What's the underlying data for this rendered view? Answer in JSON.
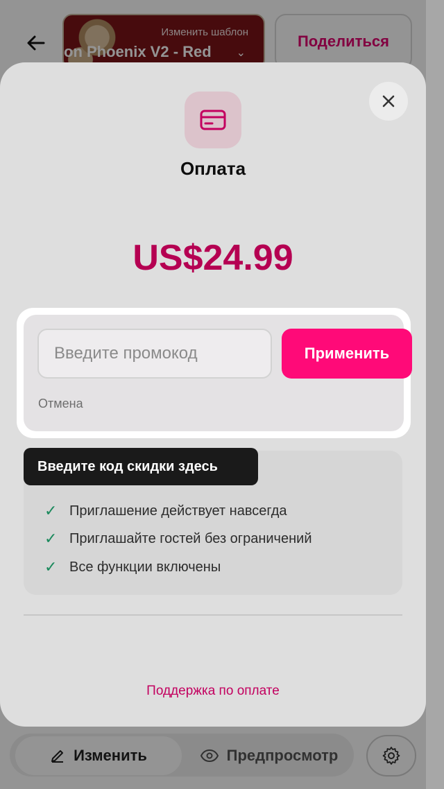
{
  "header": {
    "template_hint": "Изменить шаблон",
    "template_name": "on Phoenix V2 - Red",
    "share_label": "Поделиться"
  },
  "bottom_bar": {
    "edit_label": "Изменить",
    "preview_label": "Предпросмотр"
  },
  "modal": {
    "title": "Оплата",
    "price": "US$24.99",
    "features": [
      "Приглашение действует навсегда",
      "Приглашайте гостей без ограничений",
      "Все функции включены"
    ],
    "support_link": "Поддержка по оплате"
  },
  "promo": {
    "placeholder": "Введите промокод",
    "apply_label": "Применить",
    "cancel_label": "Отмена"
  },
  "tooltip": {
    "text": "Введите код скидки здесь"
  },
  "colors": {
    "accent": "#ff0a78",
    "price": "#d0005f",
    "link": "#e0006e",
    "check": "#1e9e6a"
  }
}
